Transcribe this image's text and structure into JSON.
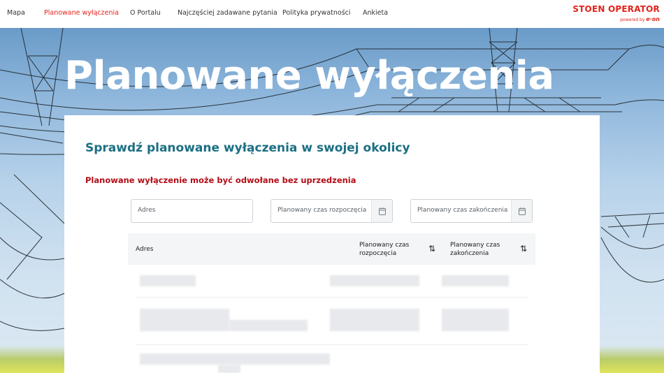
{
  "nav": {
    "items": [
      {
        "label": "Mapa",
        "active": false
      },
      {
        "label": "Planowane wyłączenia",
        "active": true
      },
      {
        "label": "O Portalu",
        "active": false
      },
      {
        "label": "Najczęściej zadawane pytania",
        "active": false
      },
      {
        "label": "Polityka prywatności",
        "active": false
      },
      {
        "label": "Ankieta",
        "active": false
      }
    ],
    "logo": {
      "brand": "STOEN OPERATOR",
      "powered": "powered by",
      "parent": "e·on"
    }
  },
  "hero": {
    "title": "Planowane wyłączenia"
  },
  "card": {
    "heading": "Sprawdź planowane wyłączenia w swojej okolicy",
    "warning": "Planowane wyłączenie może być odwołane bez uprzedzenia"
  },
  "filters": {
    "address_placeholder": "Adres",
    "start_placeholder": "Planowany czas rozpoczęcia",
    "end_placeholder": "Planowany czas zakończenia",
    "calendar_icon": "calendar-icon"
  },
  "table": {
    "columns": [
      {
        "label": "Adres",
        "sortable": false
      },
      {
        "label": "Planowany czas rozpoczęcia",
        "sortable": true
      },
      {
        "label": "Planowany czas zakończenia",
        "sortable": true
      }
    ],
    "sort_icon": "sort-arrows-icon"
  },
  "colors": {
    "accent": "#e2231a",
    "heading": "#1b6f83",
    "warning": "#b30d16"
  }
}
